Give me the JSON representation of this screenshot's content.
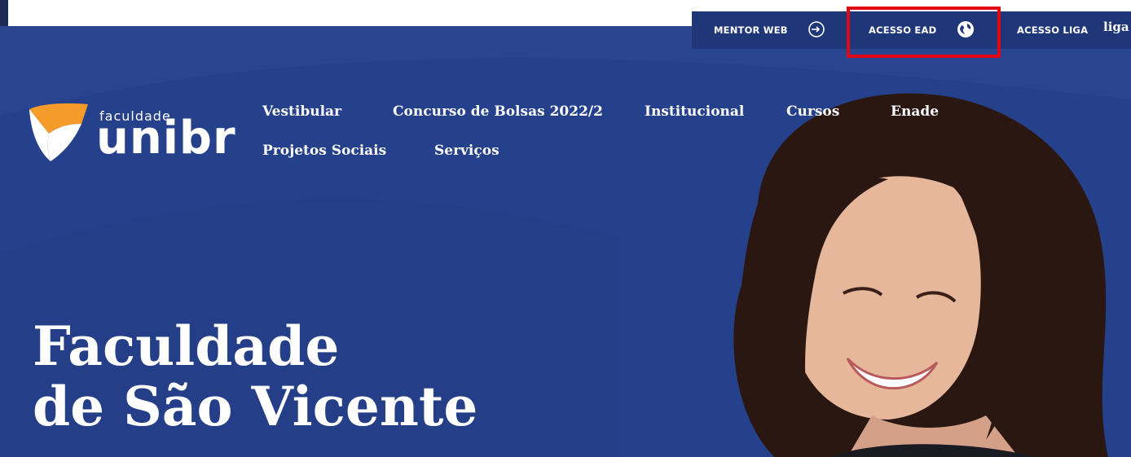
{
  "topbar": {
    "mentor_web": "MENTOR WEB",
    "acesso_ead": "ACESSO EAD",
    "acesso_liga": "ACESSO LIGA",
    "liga_logo": "liga"
  },
  "logo": {
    "small": "faculdade",
    "big": "unibr"
  },
  "nav": {
    "items": [
      {
        "label": "Vestibular"
      },
      {
        "label": "Concurso de Bolsas 2022/2"
      },
      {
        "label": "Institucional"
      },
      {
        "label": "Cursos"
      },
      {
        "label": "Enade"
      },
      {
        "label": "Projetos Sociais"
      },
      {
        "label": "Serviços"
      }
    ]
  },
  "hero": {
    "title_line1": "Faculdade",
    "title_line2": "de São Vicente"
  },
  "colors": {
    "hero_bg": "#26418c",
    "topbar_bg": "#1f3779",
    "highlight": "#e30613",
    "logo_orange": "#f39c2a"
  },
  "icons": {
    "mentor": "login-arrow-icon",
    "ead": "globe-icon"
  }
}
